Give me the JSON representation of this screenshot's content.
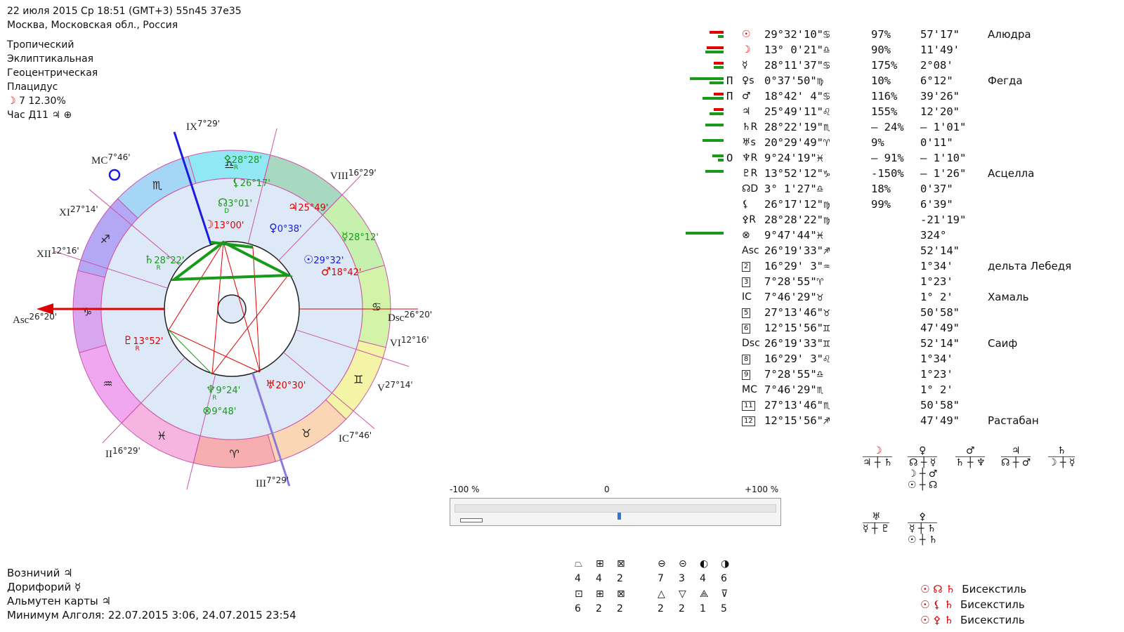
{
  "header": {
    "line1": "22 июля 2015  Ср  18:51 (GMT+3) 55n45  37e35",
    "line2": "Москва, Московская обл., Россия",
    "zodiac": "Тропический",
    "coords": "Эклиптикальная",
    "center": "Геоцентрическая",
    "houses": "Плацидус",
    "moon_glyph": "☽",
    "moon_phase": " 7 12.30%",
    "hour": "Час Д11 ♃ ⊕"
  },
  "chart": {
    "house_labels": [
      {
        "name": "IX",
        "deg": "7°29'"
      },
      {
        "name": "MC",
        "deg": "7°46'"
      },
      {
        "name": "VIII",
        "deg": "16°29'"
      },
      {
        "name": "XI",
        "deg": "27°14'"
      },
      {
        "name": "XII",
        "deg": "12°16'"
      },
      {
        "name": "Asc",
        "deg": "26°20'"
      },
      {
        "name": "Dsc",
        "deg": "26°20'"
      },
      {
        "name": "VI",
        "deg": "12°16'"
      },
      {
        "name": "V",
        "deg": "27°14'"
      },
      {
        "name": "IC",
        "deg": "7°46'"
      },
      {
        "name": "II",
        "deg": "16°29'"
      },
      {
        "name": "III",
        "deg": "7°29'"
      }
    ],
    "sign_glyphs": [
      "♎",
      "♏",
      "♐",
      "♑",
      "♒",
      "♓",
      "♈",
      "♉",
      "♊",
      "♋"
    ],
    "planets": [
      {
        "glyph": "⚴",
        "label": "28°28'",
        "sub": "R",
        "color": "#1a9a1a"
      },
      {
        "glyph": "⚸",
        "label": "26°17'",
        "sub": "",
        "color": "#1a9a1a"
      },
      {
        "glyph": "♃",
        "label": "25°49'",
        "sub": "",
        "color": "#e00000"
      },
      {
        "glyph": "☊",
        "label": "3°01'",
        "sub": "D",
        "color": "#1a9a1a"
      },
      {
        "glyph": "☽",
        "label": "13°00'",
        "sub": "",
        "color": "#e00000"
      },
      {
        "glyph": "♀",
        "label": "0°38'",
        "sub": "",
        "color": "#1a1ae0"
      },
      {
        "glyph": "☿",
        "label": "28°12'",
        "sub": "",
        "color": "#1a9a1a"
      },
      {
        "glyph": "☉",
        "label": "29°32'",
        "sub": "",
        "color": "#1a1ae0"
      },
      {
        "glyph": "♂",
        "label": "18°42'",
        "sub": "",
        "color": "#e00000"
      },
      {
        "glyph": "♄",
        "label": "28°22'",
        "sub": "R",
        "color": "#1a9a1a"
      },
      {
        "glyph": "♇",
        "label": "13°52'",
        "sub": "R",
        "color": "#e00000"
      },
      {
        "glyph": "♆",
        "label": "9°24'",
        "sub": "R",
        "color": "#1a9a1a"
      },
      {
        "glyph": "⊗",
        "label": "9°48'",
        "sub": "",
        "color": "#1a9a1a"
      },
      {
        "glyph": "♅",
        "label": "20°30'",
        "sub": "",
        "color": "#e00000"
      }
    ]
  },
  "table": [
    {
      "g": "☉",
      "gc": "#e00000",
      "pos": "29°32'10\"♋",
      "pct": "97%",
      "spd": "57'17\"",
      "star": "Алюдра",
      "bars": [
        {
          "c": "#e00000",
          "w": 20
        },
        {
          "c": "#1a9a1a",
          "w": 8
        }
      ]
    },
    {
      "g": "☽",
      "gc": "#e00000",
      "pos": "13° 0'21\"♎",
      "pct": "90%",
      "spd": "11'49'",
      "star": "",
      "bars": [
        {
          "c": "#e00000",
          "w": 24
        },
        {
          "c": "#1a9a1a",
          "w": 26
        }
      ]
    },
    {
      "g": "☿",
      "gc": "#111",
      "pos": "28°11'37\"♋",
      "pct": "175%",
      "spd": "2°08'",
      "star": "",
      "bars": [
        {
          "c": "#e00000",
          "w": 14
        },
        {
          "c": "#1a9a1a",
          "w": 14
        }
      ]
    },
    {
      "g": "♀s",
      "gc": "#111",
      "pre": "П",
      "pos": "0°37'50\"♍",
      "pct": "10%",
      "spd": "6°12\"",
      "star": "Фегда",
      "bars": [
        {
          "c": "#1a9a1a",
          "w": 48
        },
        {
          "c": "#1a9a1a",
          "w": 20
        }
      ]
    },
    {
      "g": "♂",
      "gc": "#111",
      "pre": "П",
      "pos": "18°42' 4\"♋",
      "pct": "116%",
      "spd": "39'26\"",
      "star": "",
      "bars": [
        {
          "c": "#e00000",
          "w": 14
        },
        {
          "c": "#1a9a1a",
          "w": 30
        }
      ]
    },
    {
      "g": "♃",
      "gc": "#111",
      "pos": "25°49'11\"♌",
      "pct": "155%",
      "spd": "12'20\"",
      "star": "",
      "bars": [
        {
          "c": "#e00000",
          "w": 14
        },
        {
          "c": "#1a9a1a",
          "w": 20
        }
      ]
    },
    {
      "g": "♄R",
      "gc": "#111",
      "pos": "28°22'19\"♏",
      "pct": "– 24%",
      "spd": "– 1'01\"",
      "star": "",
      "bars": [
        {
          "c": "#1a9a1a",
          "w": 26
        }
      ]
    },
    {
      "g": "♅s",
      "gc": "#111",
      "pos": "20°29'49\"♈",
      "pct": "9%",
      "spd": "0'11\"",
      "star": "",
      "bars": [
        {
          "c": "#1a9a1a",
          "w": 30
        }
      ]
    },
    {
      "g": "♆R",
      "gc": "#111",
      "pre": "О",
      "pos": "9°24'19\"♓",
      "pct": "– 91%",
      "spd": "– 1'10\"",
      "star": "",
      "bars": [
        {
          "c": "#1a9a1a",
          "w": 16
        },
        {
          "c": "#1a9a1a",
          "w": 8
        }
      ]
    },
    {
      "g": "♇R",
      "gc": "#111",
      "pos": "13°52'12\"♑",
      "pct": "-150%",
      "spd": "– 1'26\"",
      "star": "Асцелла",
      "bars": [
        {
          "c": "#1a9a1a",
          "w": 26
        }
      ]
    },
    {
      "g": "☊D",
      "gc": "#111",
      "pos": "3° 1'27\"♎",
      "pct": "18%",
      "spd": "0'37\"",
      "star": "",
      "bars": []
    },
    {
      "g": "⚸",
      "gc": "#111",
      "pos": "26°17'12\"♍",
      "pct": "99%",
      "spd": "6'39\"",
      "star": "",
      "bars": []
    },
    {
      "g": "⚴R",
      "gc": "#111",
      "pos": "28°28'22\"♍",
      "pct": "",
      "spd": "-21'19\"",
      "star": "",
      "bars": []
    },
    {
      "g": "⊗",
      "gc": "#111",
      "pos": "9°47'44\"♓",
      "pct": "",
      "spd": "324°",
      "star": "",
      "bars": [
        {
          "c": "#1a9a1a",
          "w": 54
        }
      ]
    },
    {
      "g": "Asc",
      "gc": "#111",
      "pos": "26°19'33\"♐",
      "pct": "",
      "spd": "52'14\"",
      "star": "",
      "bars": []
    },
    {
      "g": "2",
      "gc": "#111",
      "box": true,
      "pos": "16°29' 3\"♒",
      "pct": "",
      "spd": "1°34'",
      "star": "дельта Лебедя",
      "bars": []
    },
    {
      "g": "3",
      "gc": "#111",
      "box": true,
      "pos": "7°28'55\"♈",
      "pct": "",
      "spd": "1°23'",
      "star": "",
      "bars": []
    },
    {
      "g": "IC",
      "gc": "#111",
      "pos": "7°46'29\"♉",
      "pct": "",
      "spd": "1° 2'",
      "star": "Хамаль",
      "bars": []
    },
    {
      "g": "5",
      "gc": "#111",
      "box": true,
      "pos": "27°13'46\"♉",
      "pct": "",
      "spd": "50'58\"",
      "star": "",
      "bars": []
    },
    {
      "g": "6",
      "gc": "#111",
      "box": true,
      "pos": "12°15'56\"♊",
      "pct": "",
      "spd": "47'49\"",
      "star": "",
      "bars": []
    },
    {
      "g": "Dsc",
      "gc": "#111",
      "pos": "26°19'33\"♊",
      "pct": "",
      "spd": "52'14\"",
      "star": "Саиф",
      "bars": []
    },
    {
      "g": "8",
      "gc": "#111",
      "box": true,
      "pos": "16°29' 3\"♌",
      "pct": "",
      "spd": "1°34'",
      "star": "",
      "bars": []
    },
    {
      "g": "9",
      "gc": "#111",
      "box": true,
      "pos": "7°28'55\"♎",
      "pct": "",
      "spd": "1°23'",
      "star": "",
      "bars": []
    },
    {
      "g": "MC",
      "gc": "#111",
      "pos": "7°46'29\"♏",
      "pct": "",
      "spd": "1° 2'",
      "star": "",
      "bars": []
    },
    {
      "g": "11",
      "gc": "#111",
      "box": true,
      "pos": "27°13'46\"♏",
      "pct": "",
      "spd": "50'58\"",
      "star": "",
      "bars": []
    },
    {
      "g": "12",
      "gc": "#111",
      "box": true,
      "pos": "12°15'56\"♐",
      "pct": "",
      "spd": "47'49\"",
      "star": "Растабан",
      "bars": []
    }
  ],
  "slider": {
    "left": "-100 %",
    "mid": "0",
    "right": "+100 %",
    "value": 0
  },
  "dispositors": [
    {
      "top": "☽",
      "top_color": "#e00000",
      "bottom": "♃ ┼ ♄",
      "extra": []
    },
    {
      "top": "♀",
      "top_color": "#111",
      "bottom": "☊ ┼ ☿",
      "extra": [
        "☽ ┼ ♂",
        "☉ ┼ ☊"
      ]
    },
    {
      "top": "♂",
      "top_color": "#111",
      "bottom": "♄ ┼ ♆",
      "extra": []
    },
    {
      "top": "♃",
      "top_color": "#111",
      "bottom": "☊ ┼ ♂",
      "extra": []
    },
    {
      "top": "♄",
      "top_color": "#111",
      "bottom": "☽ ┼ ☿",
      "extra": []
    },
    {
      "top": "♅",
      "top_color": "#111",
      "bottom": "☿ ┼ ♇",
      "extra": []
    },
    {
      "top": "⚴",
      "top_color": "#111",
      "bottom": "☿ ┼ ♄",
      "extra": [
        "☉ ┼ ♄"
      ]
    }
  ],
  "elements": {
    "row1_glyphs": [
      "⏢",
      "⊞",
      "⊠",
      "⊖",
      "⊝",
      "◐",
      "◑"
    ],
    "row1_counts": [
      "4",
      "4",
      "2",
      "7",
      "3",
      "4",
      "6"
    ],
    "row2_glyphs": [
      "⊡",
      "⊞",
      "⊠",
      "△",
      "▽",
      "⟁",
      "⊽"
    ],
    "row2_counts": [
      "6",
      "2",
      "2",
      "2",
      "2",
      "1",
      "5"
    ]
  },
  "bottom_left": {
    "vozn": "Возничий ♃",
    "dorif": "Дорифорий ☿",
    "almuten": "Альмутен карты ♃",
    "algol": "Минимум Алголя: 22.07.2015  3:06,  24.07.2015 23:54"
  },
  "aspects": [
    {
      "glyphs": "☉ ☊ ♄",
      "name": "Бисекстиль"
    },
    {
      "glyphs": "☉ ⚸ ♄",
      "name": "Бисекстиль"
    },
    {
      "glyphs": "☉ ⚴ ♄",
      "name": "Бисекстиль"
    }
  ]
}
